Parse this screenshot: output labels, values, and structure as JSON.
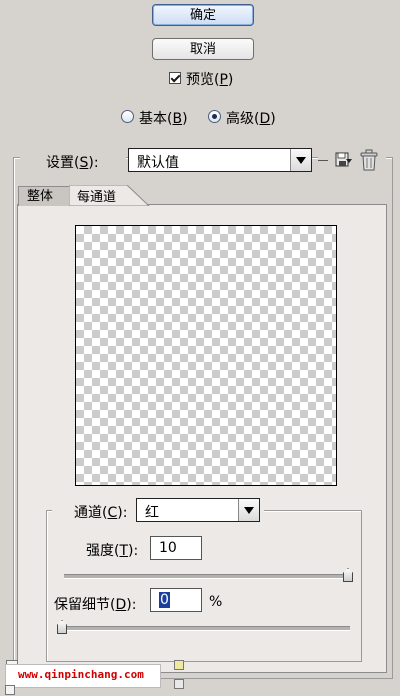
{
  "buttons": {
    "ok": "确定",
    "cancel": "取消"
  },
  "preview_check": {
    "label": "预览",
    "mnemonic": "P",
    "checked": true
  },
  "mode": {
    "basic": {
      "label": "基本",
      "mnemonic": "B",
      "selected": false
    },
    "advanced": {
      "label": "高级",
      "mnemonic": "D",
      "selected": true
    }
  },
  "settings": {
    "label": "设置",
    "mnemonic": "S",
    "value": "默认值"
  },
  "tabs": [
    {
      "label": "整体",
      "active": false
    },
    {
      "label": "每通道",
      "active": true
    }
  ],
  "channel": {
    "label": "通道",
    "mnemonic": "C",
    "value": "红"
  },
  "strength": {
    "label": "强度",
    "mnemonic": "T",
    "value": "10",
    "level": 1.0
  },
  "preserve": {
    "label": "保留细节",
    "mnemonic": "D",
    "value": "0",
    "unit": "%",
    "level": 0.0
  },
  "watermark": "www.qinpinchang.com"
}
